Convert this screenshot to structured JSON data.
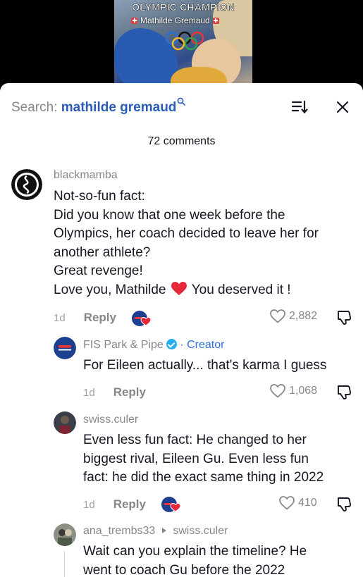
{
  "video": {
    "title": "OLYMPIC CHAMPION",
    "subtitle": "Mathilde Gremaud"
  },
  "search": {
    "label": "Search:",
    "term": "mathilde gremaud"
  },
  "comments_count": "72 comments",
  "comments": [
    {
      "username": "blackmamba",
      "text_lines": [
        "Not-so-fun fact:",
        "Did you know that one week before the",
        "Olympics, her coach decided to leave her for",
        "another athlete?",
        "Great revenge!"
      ],
      "last_line_before": "Love you, Mathilde",
      "last_line_emoji": "red-heart",
      "last_line_after": "You deserved it !",
      "age": "1d",
      "reply_label": "Reply",
      "likes": "2,882"
    }
  ],
  "replies": [
    {
      "username": "FIS Park & Pipe",
      "badge": "Creator",
      "separator": "·",
      "text": "For Eileen actually... that's karma I guess",
      "age": "1d",
      "reply_label": "Reply",
      "likes": "1,068"
    },
    {
      "username": "swiss.culer",
      "text_lines": [
        "Even less fun fact: He changed to her",
        "biggest rival, Eileen Gu. Even less fun",
        "fact: he did the exact same thing in 2022"
      ],
      "age": "1d",
      "reply_label": "Reply",
      "likes": "410"
    },
    {
      "username": "ana_trembs33",
      "reply_to": "swiss.culer",
      "text_lines": [
        "Wait can you explain the timeline? He",
        "went to coach Gu before the 2022"
      ]
    }
  ],
  "colors": {
    "accent_blue": "#2b5db8",
    "creator_blue": "#2e6fe0",
    "heart_red": "#e5283a",
    "muted_gray": "#86878b"
  }
}
